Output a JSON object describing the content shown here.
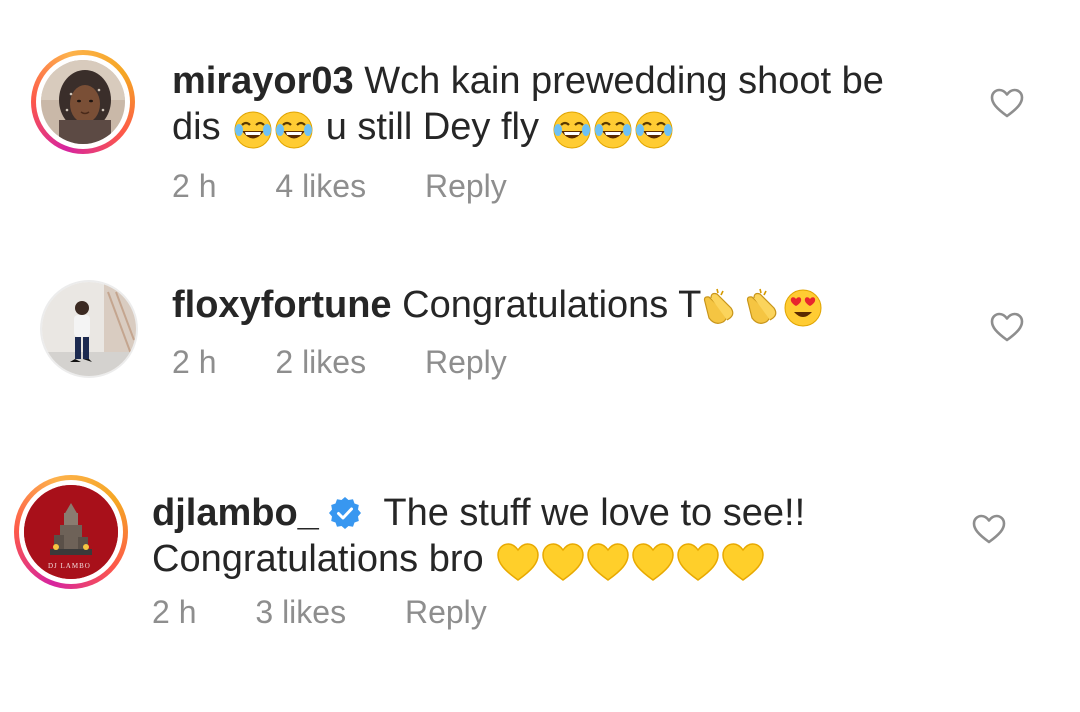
{
  "comments": [
    {
      "username": "mirayor03",
      "text_part1": "Wch kain prewedding shoot be",
      "text_part2a": "dis",
      "emoji_a": "😂😂",
      "text_part2b": "u still Dey fly",
      "emoji_b": "😂😂😂",
      "time": "2 h",
      "likes": "4 likes",
      "reply": "Reply",
      "has_story_ring": true
    },
    {
      "username": "floxyfortune",
      "text": "Congratulations T",
      "emoji": "👏👏😍",
      "time": "2 h",
      "likes": "2 likes",
      "reply": "Reply",
      "has_story_ring": false
    },
    {
      "username": "djlambo_",
      "verified": true,
      "text_part1": "The stuff we love to see!!",
      "text_part2": "Congratulations bro",
      "emoji": "💛💛💛💛💛💛",
      "avatar_text": "DJ LAMBO",
      "time": "2 h",
      "likes": "3 likes",
      "reply": "Reply",
      "has_story_ring": true
    }
  ],
  "colors": {
    "text": "#262626",
    "muted": "#8e8e8e",
    "verified": "#3897f0",
    "story_ring": [
      "#d6249f",
      "#fd5949",
      "#fdb24c"
    ]
  },
  "icons": {
    "like": "heart-outline-icon",
    "verified": "verified-badge-icon"
  }
}
